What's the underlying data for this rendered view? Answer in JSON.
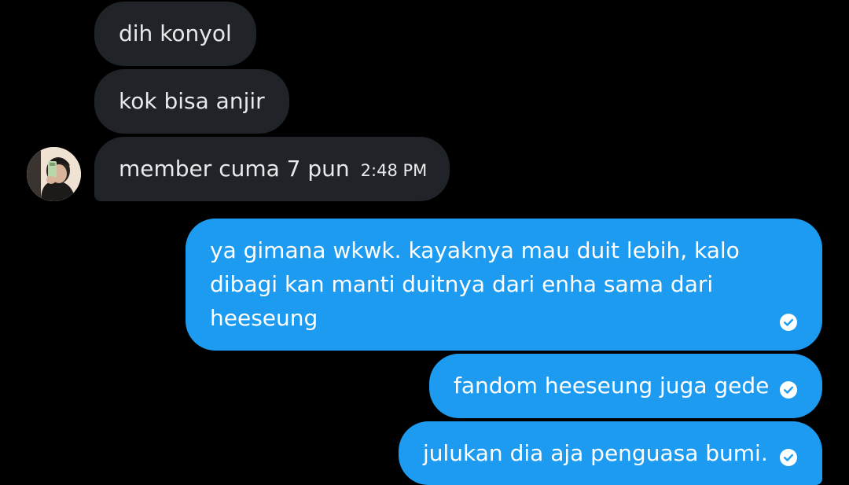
{
  "conversation": {
    "incoming": [
      {
        "text": "dih konyol"
      },
      {
        "text": "kok bisa anjir"
      },
      {
        "text": "member cuma 7 pun",
        "time": "2:48 PM"
      }
    ],
    "outgoing": [
      {
        "text": "ya gimana wkwk. kayaknya mau duit lebih, kalo dibagi kan manti duitnya dari enha sama dari heeseung",
        "status_icon": "check-circle-icon"
      },
      {
        "text": "fandom heeseung juga gede",
        "status_icon": "check-circle-icon"
      },
      {
        "text": "julukan dia aja penguasa bumi.",
        "status_icon": "check-circle-icon"
      }
    ]
  },
  "colors": {
    "background": "#000000",
    "incoming_bubble": "#202327",
    "outgoing_bubble": "#1d9bf0",
    "incoming_text": "#e7e9ea",
    "outgoing_text": "#ffffff"
  }
}
